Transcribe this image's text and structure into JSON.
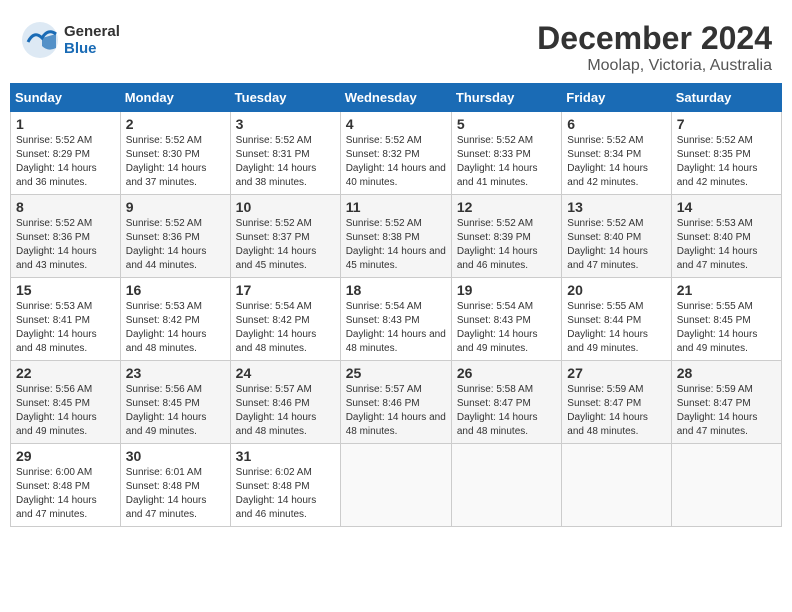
{
  "header": {
    "logo_general": "General",
    "logo_blue": "Blue",
    "main_title": "December 2024",
    "subtitle": "Moolap, Victoria, Australia"
  },
  "calendar": {
    "days_of_week": [
      "Sunday",
      "Monday",
      "Tuesday",
      "Wednesday",
      "Thursday",
      "Friday",
      "Saturday"
    ],
    "weeks": [
      [
        null,
        {
          "day": 2,
          "sunrise": "5:52 AM",
          "sunset": "8:30 PM",
          "daylight": "14 hours and 37 minutes."
        },
        {
          "day": 3,
          "sunrise": "5:52 AM",
          "sunset": "8:31 PM",
          "daylight": "14 hours and 38 minutes."
        },
        {
          "day": 4,
          "sunrise": "5:52 AM",
          "sunset": "8:32 PM",
          "daylight": "14 hours and 40 minutes."
        },
        {
          "day": 5,
          "sunrise": "5:52 AM",
          "sunset": "8:33 PM",
          "daylight": "14 hours and 41 minutes."
        },
        {
          "day": 6,
          "sunrise": "5:52 AM",
          "sunset": "8:34 PM",
          "daylight": "14 hours and 42 minutes."
        },
        {
          "day": 7,
          "sunrise": "5:52 AM",
          "sunset": "8:35 PM",
          "daylight": "14 hours and 42 minutes."
        }
      ],
      [
        {
          "day": 1,
          "sunrise": "5:52 AM",
          "sunset": "8:29 PM",
          "daylight": "14 hours and 36 minutes."
        },
        {
          "day": 8,
          "sunrise": null,
          "sunset": null,
          "daylight": null
        },
        {
          "day": 9,
          "sunrise": null,
          "sunset": null,
          "daylight": null
        },
        {
          "day": 10,
          "sunrise": null,
          "sunset": null,
          "daylight": null
        },
        {
          "day": 11,
          "sunrise": null,
          "sunset": null,
          "daylight": null
        },
        {
          "day": 12,
          "sunrise": null,
          "sunset": null,
          "daylight": null
        },
        {
          "day": 13,
          "sunrise": null,
          "sunset": null,
          "daylight": null
        }
      ],
      [
        {
          "day": 15,
          "sunrise": "5:53 AM",
          "sunset": "8:41 PM",
          "daylight": "14 hours and 48 minutes."
        },
        {
          "day": 16,
          "sunrise": "5:53 AM",
          "sunset": "8:42 PM",
          "daylight": "14 hours and 48 minutes."
        },
        {
          "day": 17,
          "sunrise": "5:54 AM",
          "sunset": "8:42 PM",
          "daylight": "14 hours and 48 minutes."
        },
        {
          "day": 18,
          "sunrise": "5:54 AM",
          "sunset": "8:43 PM",
          "daylight": "14 hours and 48 minutes."
        },
        {
          "day": 19,
          "sunrise": "5:54 AM",
          "sunset": "8:43 PM",
          "daylight": "14 hours and 49 minutes."
        },
        {
          "day": 20,
          "sunrise": "5:55 AM",
          "sunset": "8:44 PM",
          "daylight": "14 hours and 49 minutes."
        },
        {
          "day": 21,
          "sunrise": "5:55 AM",
          "sunset": "8:45 PM",
          "daylight": "14 hours and 49 minutes."
        }
      ],
      [
        {
          "day": 22,
          "sunrise": "5:56 AM",
          "sunset": "8:45 PM",
          "daylight": "14 hours and 49 minutes."
        },
        {
          "day": 23,
          "sunrise": "5:56 AM",
          "sunset": "8:45 PM",
          "daylight": "14 hours and 49 minutes."
        },
        {
          "day": 24,
          "sunrise": "5:57 AM",
          "sunset": "8:46 PM",
          "daylight": "14 hours and 48 minutes."
        },
        {
          "day": 25,
          "sunrise": "5:57 AM",
          "sunset": "8:46 PM",
          "daylight": "14 hours and 48 minutes."
        },
        {
          "day": 26,
          "sunrise": "5:58 AM",
          "sunset": "8:47 PM",
          "daylight": "14 hours and 48 minutes."
        },
        {
          "day": 27,
          "sunrise": "5:59 AM",
          "sunset": "8:47 PM",
          "daylight": "14 hours and 48 minutes."
        },
        {
          "day": 28,
          "sunrise": "5:59 AM",
          "sunset": "8:47 PM",
          "daylight": "14 hours and 47 minutes."
        }
      ],
      [
        {
          "day": 29,
          "sunrise": "6:00 AM",
          "sunset": "8:48 PM",
          "daylight": "14 hours and 47 minutes."
        },
        {
          "day": 30,
          "sunrise": "6:01 AM",
          "sunset": "8:48 PM",
          "daylight": "14 hours and 47 minutes."
        },
        {
          "day": 31,
          "sunrise": "6:02 AM",
          "sunset": "8:48 PM",
          "daylight": "14 hours and 46 minutes."
        },
        null,
        null,
        null,
        null
      ]
    ],
    "week2_details": [
      {
        "day": 8,
        "sunrise": "5:52 AM",
        "sunset": "8:36 PM",
        "daylight": "14 hours and 43 minutes."
      },
      {
        "day": 9,
        "sunrise": "5:52 AM",
        "sunset": "8:36 PM",
        "daylight": "14 hours and 44 minutes."
      },
      {
        "day": 10,
        "sunrise": "5:52 AM",
        "sunset": "8:37 PM",
        "daylight": "14 hours and 45 minutes."
      },
      {
        "day": 11,
        "sunrise": "5:52 AM",
        "sunset": "8:38 PM",
        "daylight": "14 hours and 45 minutes."
      },
      {
        "day": 12,
        "sunrise": "5:52 AM",
        "sunset": "8:39 PM",
        "daylight": "14 hours and 46 minutes."
      },
      {
        "day": 13,
        "sunrise": "5:52 AM",
        "sunset": "8:40 PM",
        "daylight": "14 hours and 47 minutes."
      },
      {
        "day": 14,
        "sunrise": "5:53 AM",
        "sunset": "8:40 PM",
        "daylight": "14 hours and 47 minutes."
      }
    ]
  }
}
